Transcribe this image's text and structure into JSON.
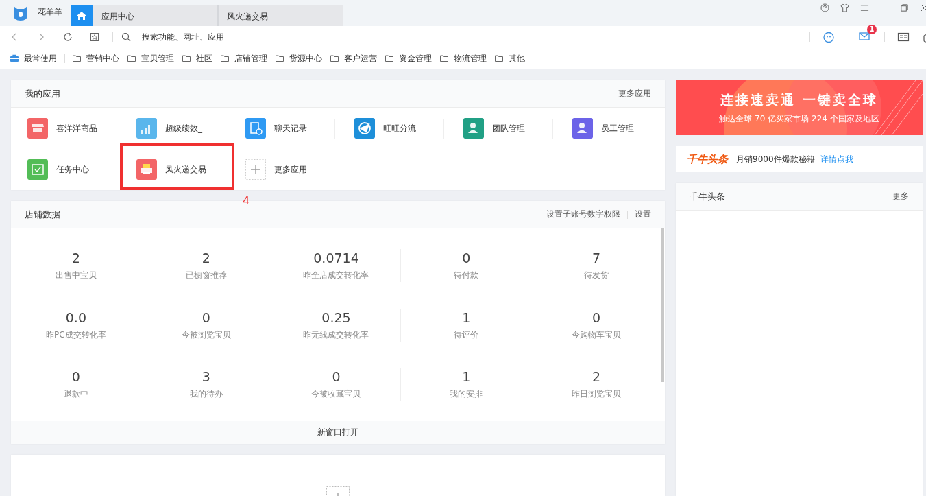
{
  "window": {
    "app_name": "花羊羊",
    "tabs": [
      {
        "kind": "home",
        "selected": true
      },
      {
        "kind": "page",
        "label": "应用中心",
        "selected": false
      },
      {
        "kind": "page",
        "label": "风火递交易",
        "selected": false
      }
    ]
  },
  "address_bar": {
    "placeholder": "搜索功能、网址、应用",
    "mail_badge": "1"
  },
  "bookmarks": [
    {
      "kind": "favorite",
      "label": "最常使用"
    },
    {
      "kind": "folder",
      "label": "营销中心"
    },
    {
      "kind": "folder",
      "label": "宝贝管理"
    },
    {
      "kind": "folder",
      "label": "社区"
    },
    {
      "kind": "folder",
      "label": "店铺管理"
    },
    {
      "kind": "folder",
      "label": "货源中心"
    },
    {
      "kind": "folder",
      "label": "客户运营"
    },
    {
      "kind": "folder",
      "label": "资金管理"
    },
    {
      "kind": "folder",
      "label": "物流管理"
    },
    {
      "kind": "folder",
      "label": "其他"
    }
  ],
  "my_apps": {
    "title": "我的应用",
    "more": "更多应用",
    "annotation": "4",
    "apps": [
      {
        "label": "喜洋洋商品",
        "color": "#f36567",
        "kind": "shop",
        "highlighted": false
      },
      {
        "label": "超级绩效_",
        "color": "#5ab6ec",
        "kind": "chart",
        "highlighted": false
      },
      {
        "label": "聊天记录",
        "color": "#2f9af3",
        "kind": "doc",
        "highlighted": false
      },
      {
        "label": "旺旺分流",
        "color": "#1e8fd9",
        "kind": "plane",
        "highlighted": false
      },
      {
        "label": "团队管理",
        "color": "#21a085",
        "kind": "user",
        "highlighted": false
      },
      {
        "label": "员工管理",
        "color": "#6c63e8",
        "kind": "user",
        "highlighted": false
      },
      {
        "label": "任务中心",
        "color": "#53bd57",
        "kind": "calendar",
        "highlighted": false
      },
      {
        "label": "风火递交易",
        "color": "#f36567",
        "kind": "printer",
        "highlighted": true
      },
      {
        "label": "更多应用",
        "color": "#cccccc",
        "kind": "add",
        "highlighted": false
      }
    ]
  },
  "store_data": {
    "title": "店铺数据",
    "links": [
      "设置子账号数字权限",
      "设置"
    ],
    "footer": "新窗口打开",
    "stats": [
      {
        "value": "2",
        "label": "出售中宝贝"
      },
      {
        "value": "2",
        "label": "已橱窗推荐"
      },
      {
        "value": "0.0714",
        "label": "昨全店成交转化率"
      },
      {
        "value": "0",
        "label": "待付款"
      },
      {
        "value": "7",
        "label": "待发货"
      },
      {
        "value": "0.0",
        "label": "昨PC成交转化率"
      },
      {
        "value": "0",
        "label": "今被浏览宝贝"
      },
      {
        "value": "0.25",
        "label": "昨无线成交转化率"
      },
      {
        "value": "1",
        "label": "待评价"
      },
      {
        "value": "0",
        "label": "今购物车宝贝"
      },
      {
        "value": "0",
        "label": "退款中"
      },
      {
        "value": "3",
        "label": "我的待办"
      },
      {
        "value": "0",
        "label": "今被收藏宝贝"
      },
      {
        "value": "1",
        "label": "我的安排"
      },
      {
        "value": "2",
        "label": "昨日浏览宝贝"
      }
    ]
  },
  "banner": {
    "headline": "连接速卖通 一键卖全球",
    "subline": "触达全球 70 亿买家市场 224 个国家及地区"
  },
  "promo": {
    "logo": "千牛头条",
    "text": "月销9000件爆款秘籍",
    "link": "详情点我"
  },
  "news": {
    "title": "千牛头条",
    "more": "更多"
  }
}
